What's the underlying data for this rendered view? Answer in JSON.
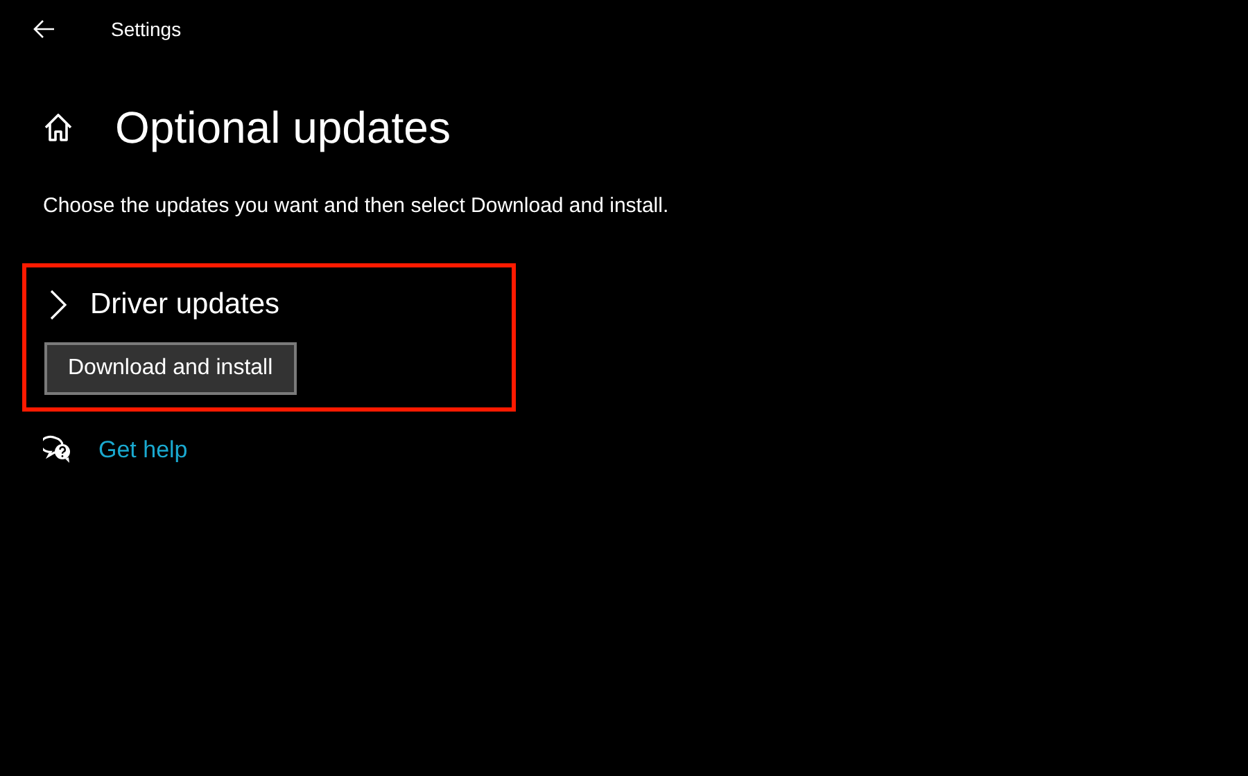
{
  "window": {
    "title": "Settings"
  },
  "page": {
    "title": "Optional updates",
    "description": "Choose the updates you want and then select Download and install."
  },
  "sections": [
    {
      "title": "Driver updates",
      "expanded": false
    }
  ],
  "buttons": [
    "Download and install"
  ],
  "help_link": "Get help"
}
